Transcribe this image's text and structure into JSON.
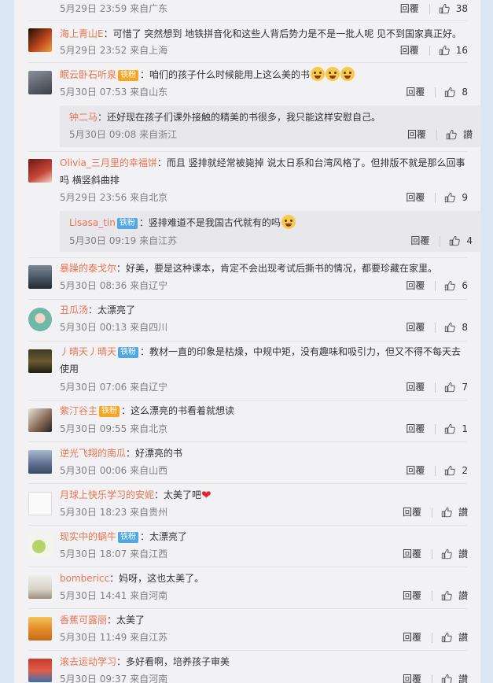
{
  "comments": [
    {
      "date": "5月29日 23:59 来自广东",
      "reply": "回覆",
      "likes": "38"
    },
    {
      "nick": "海上青山E",
      "text": "可惜了 突然想到 地铁拼音化和这些人背后势力是不是一批人呢 见不到国家真正好。",
      "date": "5月29日 23:52 来自上海",
      "reply": "回覆",
      "likes": "16"
    },
    {
      "nick": "眠云卧石听泉",
      "badge": "铁粉",
      "text": "咱们的孩子什么时候能用上这么美的书",
      "date": "5月30日 07:53 来自山东",
      "reply": "回覆",
      "likes": "8"
    },
    {
      "nick": "钟二马",
      "text": "还好现在孩子们课外接触的精美的书很多，我只能这样安慰自己。",
      "date": "5月30日 09:08 来自浙江",
      "reply": "回覆",
      "likes": "讃"
    },
    {
      "nick": "Olivia_三月里的幸福饼",
      "text": "而且 竖排就经常被毙掉 说太日系和台湾风格了。但排版不就是那么回事吗 横竖斜曲排",
      "date": "5月29日 23:56 来自北京",
      "reply": "回覆",
      "likes": "9"
    },
    {
      "nick": "Lisasa_tin",
      "badge": "铁粉",
      "text": "竖排难道不是我国古代就有的吗",
      "date": "5月30日 09:19 来自江苏",
      "reply": "回覆",
      "likes": "4"
    },
    {
      "nick": "暴躁的泰戈尔",
      "text": "好美，要是这种课本，肯定不会出现考试后撕书的情况，都要珍藏在家里。",
      "date": "5月30日 08:36 来自辽宁",
      "reply": "回覆",
      "likes": "6"
    },
    {
      "nick": "丑瓜汤",
      "text": "太漂亮了",
      "date": "5月30日 00:13 来自四川",
      "reply": "回覆",
      "likes": "8"
    },
    {
      "nick": "丿晴天丿晴天",
      "badge": "铁粉",
      "text": "教材一直的印象是枯燥，中规中矩，没有趣味和吸引力，但又不得不每天去使用",
      "date": "5月30日 07:06 来自辽宁",
      "reply": "回覆",
      "likes": "7"
    },
    {
      "nick": "紫汀谷主",
      "badge": "铁粉",
      "text": "这么漂亮的书看着就想读",
      "date": "5月30日 09:55 来自北京",
      "reply": "回覆",
      "likes": "1"
    },
    {
      "nick": "逆光飞翔的南瓜",
      "text": "好漂亮的书",
      "date": "5月30日 00:06 来自山西",
      "reply": "回覆",
      "likes": "2"
    },
    {
      "nick": "月球上快乐学习的安妮",
      "text": "太美了吧",
      "date": "5月30日 18:23 来自贵州",
      "reply": "回覆",
      "likes": "讃"
    },
    {
      "nick": "现实中的蜗牛",
      "badge": "铁粉",
      "text": "太漂亮了",
      "date": "5月30日 18:07 来自江西",
      "reply": "回覆",
      "likes": "讃"
    },
    {
      "nick": "bombericc",
      "text": "妈呀，这也太美了。",
      "date": "5月30日 14:41 来自河南",
      "reply": "回覆",
      "likes": "讃"
    },
    {
      "nick": "香蕉可露丽",
      "text": "太美了",
      "date": "5月30日 11:49 来自江苏",
      "reply": "回覆",
      "likes": "讃"
    },
    {
      "nick": "滚去运动学习",
      "text": "多好看啊，培养孩子审美",
      "date": "5月30日 09:37 来自河南",
      "reply": "回覆",
      "likes": "讃"
    }
  ],
  "colors": {
    "nick": "#eb7350",
    "page_bg": "#dbe6f3",
    "panel_bg": "#f2f2f5",
    "sub_bg": "#e8e8ec",
    "badge": "#4fa7e3"
  },
  "icons": {
    "like": "thumbs-up-icon",
    "emoji": "crying-laughing-emoji",
    "heart": "red-heart-emoji"
  }
}
